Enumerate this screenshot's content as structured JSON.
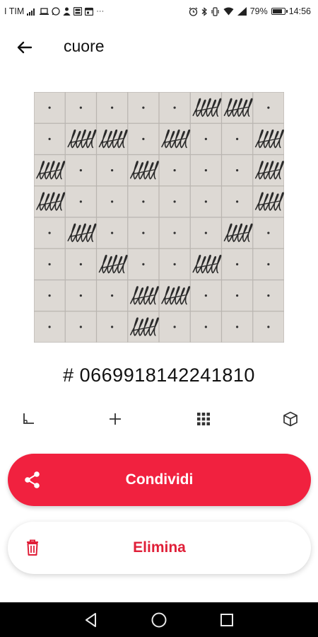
{
  "status_bar": {
    "carrier": "I TIM",
    "battery_percent": "79%",
    "time": "14:56"
  },
  "app_bar": {
    "title": "cuore",
    "back_icon": "arrow-back-icon"
  },
  "drawing": {
    "grid_rows": 8,
    "grid_cols": 8,
    "filled_cells": [
      [
        0,
        5
      ],
      [
        0,
        6
      ],
      [
        1,
        1
      ],
      [
        1,
        2
      ],
      [
        1,
        4
      ],
      [
        1,
        7
      ],
      [
        2,
        0
      ],
      [
        2,
        3
      ],
      [
        2,
        7
      ],
      [
        3,
        0
      ],
      [
        3,
        7
      ],
      [
        4,
        1
      ],
      [
        4,
        6
      ],
      [
        5,
        2
      ],
      [
        5,
        5
      ],
      [
        6,
        3
      ],
      [
        6,
        4
      ],
      [
        7,
        3
      ]
    ]
  },
  "code": "# 0669918142241810",
  "tools": [
    {
      "icon": "axis-icon"
    },
    {
      "icon": "plus-icon"
    },
    {
      "icon": "grid-icon"
    },
    {
      "icon": "cube-icon"
    }
  ],
  "buttons": {
    "share_label": "Condividi",
    "delete_label": "Elimina"
  },
  "colors": {
    "primary": "#f1213f",
    "delete_text": "#e01f38",
    "paper": "#ddd9d4"
  }
}
